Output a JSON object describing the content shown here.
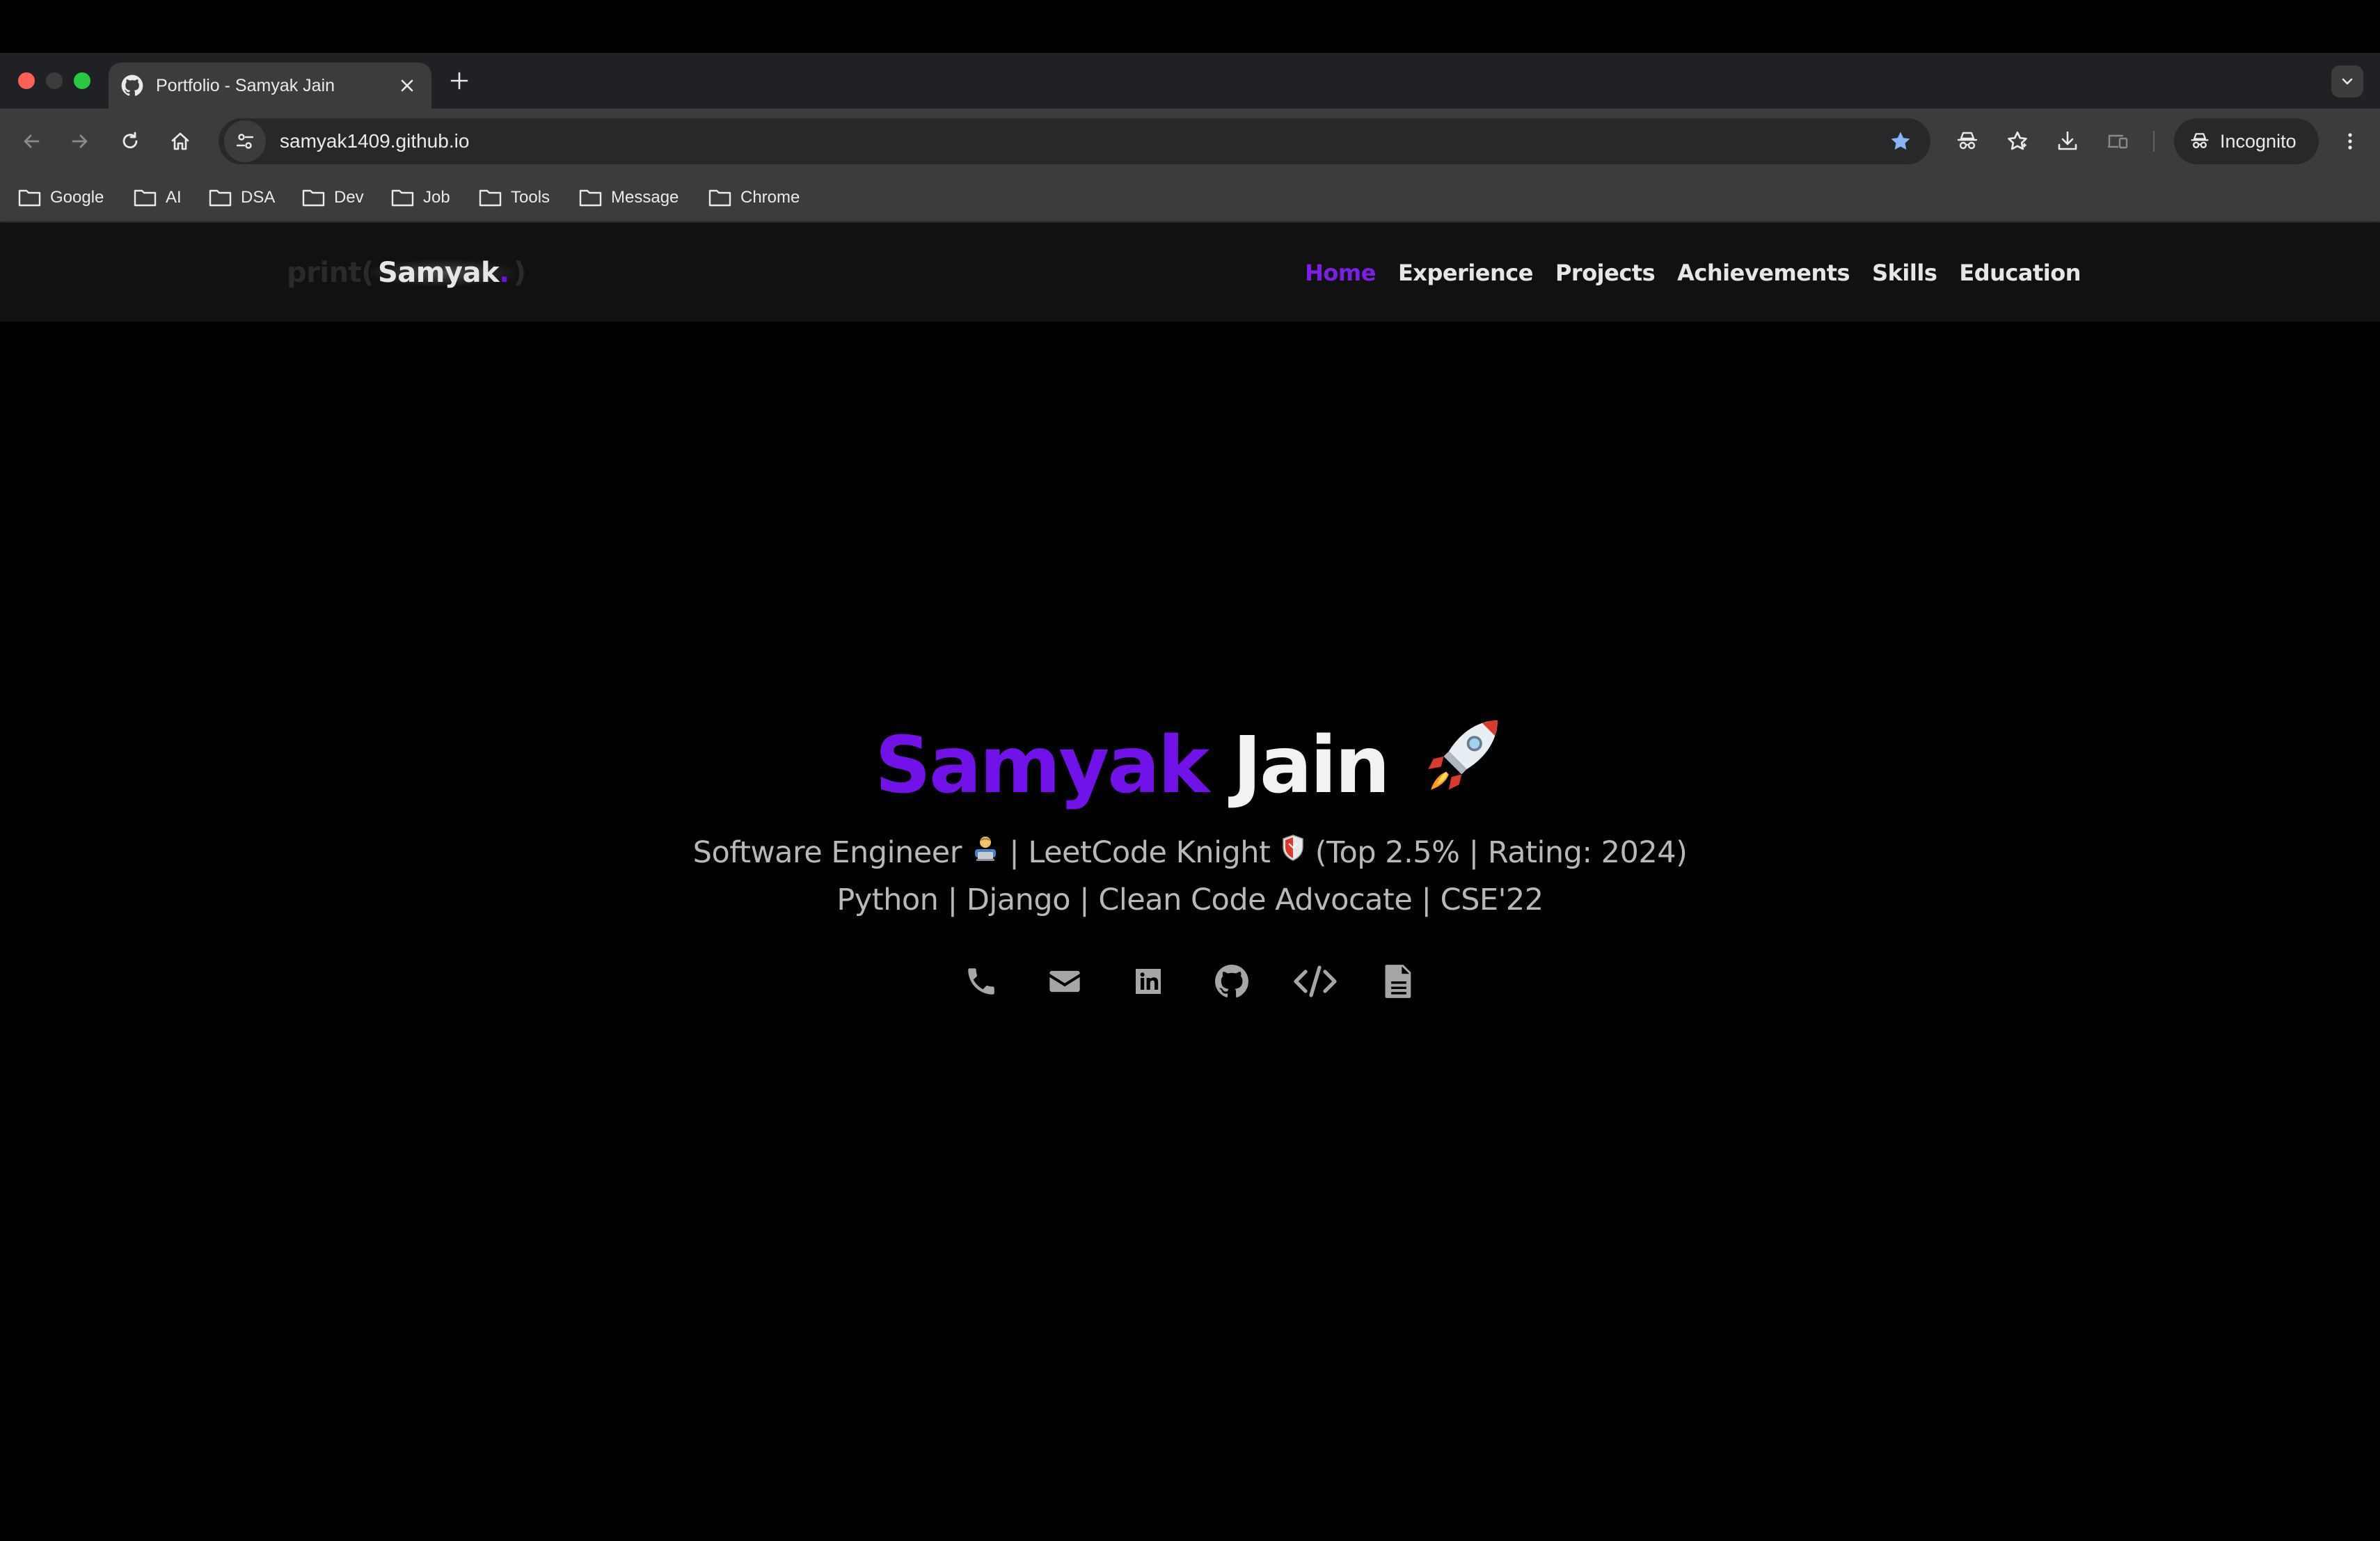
{
  "browser": {
    "tab": {
      "title": "Portfolio - Samyak Jain",
      "favicon": "github-icon"
    },
    "url": "samyak1409.github.io",
    "profile_label": "Incognito",
    "bookmarks": [
      "Google",
      "AI",
      "DSA",
      "Dev",
      "Job",
      "Tools",
      "Message",
      "Chrome"
    ]
  },
  "site": {
    "logo": {
      "prefix": "print(",
      "name": "Samyak",
      "dot": ".",
      "suffix": ")"
    },
    "nav": [
      "Home",
      "Experience",
      "Projects",
      "Achievements",
      "Skills",
      "Education"
    ],
    "active_nav": "Home",
    "hero": {
      "first_name": "Samyak",
      "last_name": "Jain",
      "title_emoji": "rocket",
      "line1": {
        "part1": "Software Engineer",
        "part2": "| LeetCode Knight",
        "part3": "(Top 2.5% | Rating: 2024)"
      },
      "line2": "Python | Django | Clean Code Advocate | CSE'22"
    },
    "socials": [
      "phone-icon",
      "email-icon",
      "linkedin-icon",
      "github-icon",
      "code-icon",
      "resume-icon"
    ]
  },
  "colors": {
    "accent": "#7112e8",
    "nav_active": "#7b1fe8",
    "background": "#000000",
    "navbar": "#111111",
    "icon": "#a6a6a6"
  }
}
